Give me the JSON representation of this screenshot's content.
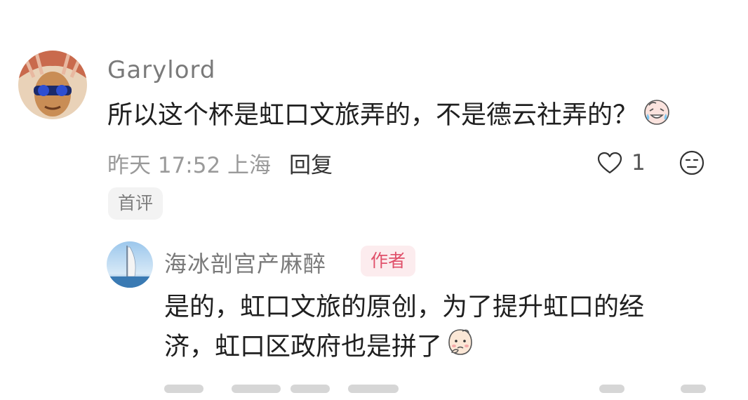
{
  "comment": {
    "username": "Garylord",
    "text": "所以这个杯是虹口文旅弄的，不是德云社弄的？",
    "emoji_icon": "crying-laughing-emoji-icon",
    "time_location": "昨天 17:52 上海",
    "reply_label": "回复",
    "like_count": "1",
    "first_badge": "首评"
  },
  "reply": {
    "username": "海冰剖宫产麻醉",
    "author_badge": "作者",
    "text_line1": "是的，虹口文旅的原创，为了提升虹口的经",
    "text_line2": "济，虹口区政府也是拼了",
    "emoji_icon": "thinking-face-emoji-icon"
  },
  "colors": {
    "author_badge_text": "#e0506a",
    "author_badge_bg": "#fcecee",
    "meta_gray": "#9a9a9a"
  }
}
